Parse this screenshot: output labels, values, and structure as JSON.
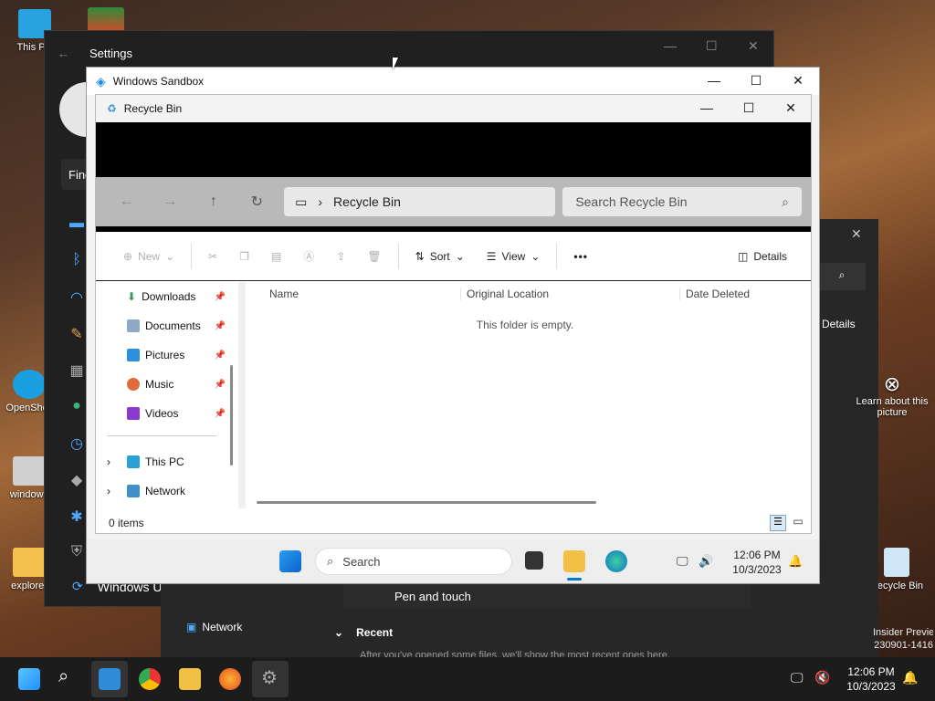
{
  "desktop": {
    "icons": [
      {
        "label": "This PC"
      },
      {
        "label": "OpenShell"
      },
      {
        "label": "windows"
      },
      {
        "label": "explorer"
      },
      {
        "label": "Recycle Bin"
      }
    ],
    "right_panel": {
      "learn_label": "Learn about this picture",
      "insider_label": "Insider Preview",
      "build_label": "230901-1416"
    }
  },
  "settings": {
    "title": "Settings",
    "find_placeholder": "Find",
    "windows_update": "Windows Update",
    "pen_and_touch": "Pen and touch",
    "details": "Details"
  },
  "background_explorer": {
    "network": "Network",
    "recent": "Recent",
    "recent_text": "After you've opened some files, we'll show the most recent ones here."
  },
  "sandbox": {
    "title": "Windows Sandbox"
  },
  "explorer": {
    "title": "Recycle Bin",
    "address": "Recycle Bin",
    "search_placeholder": "Search Recycle Bin",
    "commands": {
      "new": "New",
      "sort": "Sort",
      "view": "View",
      "details": "Details"
    },
    "nav_items": [
      {
        "label": "Downloads"
      },
      {
        "label": "Documents"
      },
      {
        "label": "Pictures"
      },
      {
        "label": "Music"
      },
      {
        "label": "Videos"
      },
      {
        "label": "This PC"
      },
      {
        "label": "Network"
      }
    ],
    "columns": [
      "Name",
      "Original Location",
      "Date Deleted"
    ],
    "empty_message": "This folder is empty.",
    "status": "0 items"
  },
  "inner_taskbar": {
    "search_label": "Search",
    "time": "12:06 PM",
    "date": "10/3/2023"
  },
  "outer_taskbar": {
    "time": "12:06 PM",
    "date": "10/3/2023"
  },
  "colors": {
    "accent": "#0078d4",
    "settings_bg": "#202020",
    "nav_bar_bg": "#b9b9b9"
  }
}
